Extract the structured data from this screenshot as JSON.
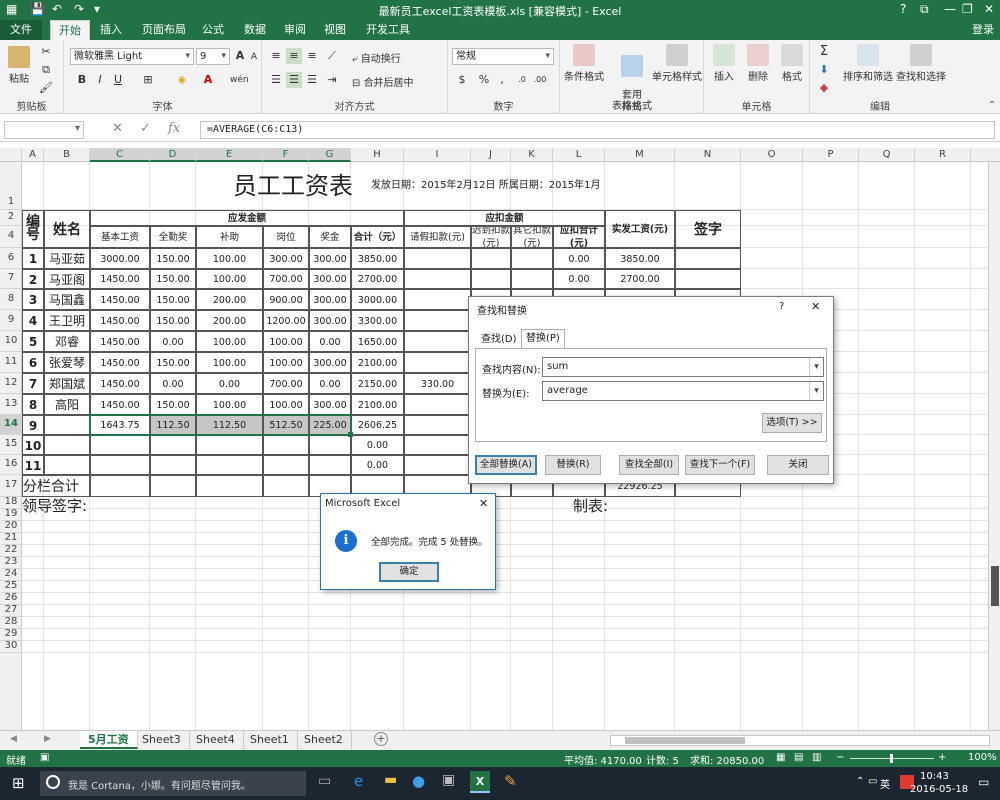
{
  "titlebar": {
    "title": "最新员工excel工资表模板.xls  [兼容模式] - Excel",
    "quick_access": [
      "save-icon",
      "undo-icon",
      "redo-icon",
      "customize-icon"
    ],
    "window_controls": {
      "help": "?",
      "restore": "⧉",
      "minimize": "—",
      "maximize": "❐",
      "close": "✕"
    }
  },
  "tabs": [
    {
      "label": "文件"
    },
    {
      "label": "开始"
    },
    {
      "label": "插入"
    },
    {
      "label": "页面布局"
    },
    {
      "label": "公式"
    },
    {
      "label": "数据"
    },
    {
      "label": "审阅"
    },
    {
      "label": "视图"
    },
    {
      "label": "开发工具"
    }
  ],
  "login": "登录",
  "ribbon": {
    "clipboard": {
      "label": "剪贴板",
      "paste": "粘贴"
    },
    "font": {
      "label": "字体",
      "family": "微软雅黑 Light",
      "size": "9",
      "bold": "B",
      "italic": "I",
      "underline": "U",
      "grow": "A",
      "shrink": "A",
      "phonetic": "wén"
    },
    "alignment": {
      "label": "对齐方式",
      "wrap": "自动换行",
      "merge": "合并后居中"
    },
    "number": {
      "label": "数字",
      "format": "常规"
    },
    "styles": {
      "label": "样式",
      "conditional": "条件格式",
      "table": "套用\n表格格式",
      "cell": "单元格样式"
    },
    "cells": {
      "label": "单元格",
      "insert": "插入",
      "delete": "删除",
      "format": "格式"
    },
    "editing": {
      "label": "编辑",
      "sort": "排序和筛选",
      "find": "查找和选择"
    }
  },
  "formula_bar": {
    "name": "",
    "fx": "fx",
    "formula": "=AVERAGE(C6:C13)"
  },
  "columns": [
    "A",
    "B",
    "C",
    "D",
    "E",
    "F",
    "G",
    "H",
    "I",
    "J",
    "K",
    "L",
    "M",
    "N",
    "O",
    "P",
    "Q",
    "R"
  ],
  "rows": [
    "1",
    "2",
    "4",
    "6",
    "7",
    "8",
    "9",
    "10",
    "11",
    "12",
    "13",
    "14",
    "15",
    "16",
    "17",
    "18",
    "19",
    "20",
    "21",
    "22",
    "23",
    "24",
    "25",
    "26",
    "27",
    "28",
    "29",
    "30"
  ],
  "sheet": {
    "title": "员工工资表",
    "issue_info": "发放日期：2015年2月12日 所属日期：2015年1月",
    "headers": {
      "no": "编号",
      "name": "姓名",
      "payable": "应发金额",
      "deduct": "应扣金额",
      "base": "基本工资",
      "attendance": "全勤奖",
      "subsidy": "补助",
      "post": "岗位",
      "bonus": "奖金",
      "total": "合计（元）",
      "leave": "请假扣款(元)",
      "late": "迟到扣款(元)",
      "other": "其它扣款(元)",
      "deduct_total": "应扣合计(元)",
      "net": "实发工资(元)",
      "sign": "签字"
    },
    "rows": [
      {
        "no": "1",
        "name": "马亚茹",
        "base": "3000.00",
        "att": "150.00",
        "sub": "100.00",
        "post": "300.00",
        "bonus": "300.00",
        "total": "3850.00",
        "leave": "",
        "dtotal": "0.00",
        "net": "3850.00"
      },
      {
        "no": "2",
        "name": "马亚阁",
        "base": "1450.00",
        "att": "150.00",
        "sub": "100.00",
        "post": "700.00",
        "bonus": "300.00",
        "total": "2700.00",
        "leave": "",
        "dtotal": "0.00",
        "net": "2700.00"
      },
      {
        "no": "3",
        "name": "马国鑫",
        "base": "1450.00",
        "att": "150.00",
        "sub": "200.00",
        "post": "900.00",
        "bonus": "300.00",
        "total": "3000.00",
        "leave": "",
        "dtotal": "",
        "net": ""
      },
      {
        "no": "4",
        "name": "王卫明",
        "base": "1450.00",
        "att": "150.00",
        "sub": "200.00",
        "post": "1200.00",
        "bonus": "300.00",
        "total": "3300.00",
        "leave": "",
        "dtotal": "",
        "net": ""
      },
      {
        "no": "5",
        "name": "邓睿",
        "base": "1450.00",
        "att": "0.00",
        "sub": "100.00",
        "post": "100.00",
        "bonus": "0.00",
        "total": "1650.00",
        "leave": "",
        "dtotal": "",
        "net": ""
      },
      {
        "no": "6",
        "name": "张爱琴",
        "base": "1450.00",
        "att": "150.00",
        "sub": "100.00",
        "post": "100.00",
        "bonus": "300.00",
        "total": "2100.00",
        "leave": "",
        "dtotal": "",
        "net": ""
      },
      {
        "no": "7",
        "name": "郑国斌",
        "base": "1450.00",
        "att": "0.00",
        "sub": "0.00",
        "post": "700.00",
        "bonus": "0.00",
        "total": "2150.00",
        "leave": "330.00",
        "dtotal": "",
        "net": ""
      },
      {
        "no": "8",
        "name": "高阳",
        "base": "1450.00",
        "att": "150.00",
        "sub": "100.00",
        "post": "100.00",
        "bonus": "300.00",
        "total": "2100.00",
        "leave": "",
        "dtotal": "",
        "net": ""
      },
      {
        "no": "9",
        "name": "",
        "base": "1643.75",
        "att": "112.50",
        "sub": "112.50",
        "post": "512.50",
        "bonus": "225.00",
        "total": "2606.25",
        "leave": "",
        "dtotal": "",
        "net": ""
      },
      {
        "no": "10",
        "name": "",
        "base": "",
        "att": "",
        "sub": "",
        "post": "",
        "bonus": "",
        "total": "0.00",
        "leave": "",
        "dtotal": "",
        "net": ""
      },
      {
        "no": "11",
        "name": "",
        "base": "",
        "att": "",
        "sub": "",
        "post": "",
        "bonus": "",
        "total": "0.00",
        "leave": "",
        "dtotal": "",
        "net": ""
      }
    ],
    "subtotal_label": "分栏合计",
    "subtotal_net": "22926.25",
    "leader_sign": "领导签字:",
    "maker": "制表:"
  },
  "find_replace": {
    "title": "查找和替换",
    "help": "?",
    "close": "✕",
    "tab_find": "查找(D)",
    "tab_replace": "替换(P)",
    "find_label": "查找内容(N):",
    "find_value": "sum",
    "replace_label": "替换为(E):",
    "replace_value": "average",
    "options": "选项(T) >>",
    "replace_all": "全部替换(A)",
    "replace": "替换(R)",
    "find_all": "查找全部(I)",
    "find_next": "查找下一个(F)",
    "close_btn": "关闭"
  },
  "msgbox": {
    "title": "Microsoft Excel",
    "close": "✕",
    "message": "全部完成。完成 5 处替换。",
    "ok": "确定",
    "info_glyph": "i"
  },
  "sheet_tabs": [
    "5月工资",
    "Sheet3",
    "Sheet4",
    "Sheet1",
    "Sheet2"
  ],
  "status": {
    "ready": "就绪",
    "average": "平均值: 4170.00",
    "count": "计数: 5",
    "sum": "求和: 20850.00",
    "zoom": "100%"
  },
  "taskbar": {
    "cortana": "我是 Cortana，小娜。有问题尽管问我。",
    "ime": "英",
    "time": "10:43",
    "date": "2016-05-18"
  },
  "colors": {
    "excel_green": "#217346",
    "selection_gray": "#c6c6c6",
    "taskbar": "#1c2631",
    "info_blue": "#1d6fcf"
  }
}
